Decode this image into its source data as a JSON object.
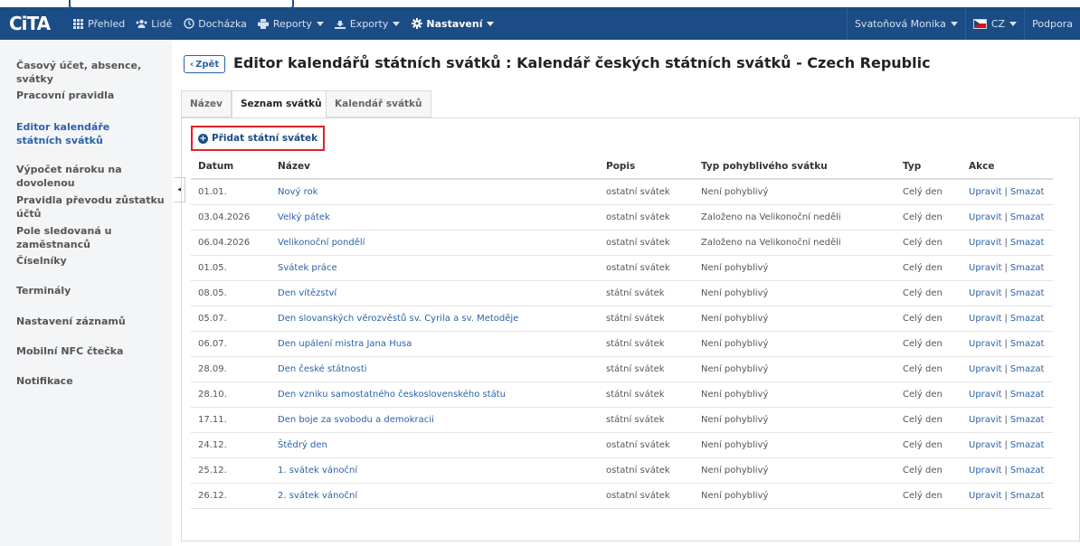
{
  "brand": {
    "logo": "CiTA"
  },
  "nav": {
    "items": [
      {
        "label": "Přehled",
        "icon": "grid-icon"
      },
      {
        "label": "Lidé",
        "icon": "people-icon"
      },
      {
        "label": "Docházka",
        "icon": "clock-icon"
      },
      {
        "label": "Reporty",
        "icon": "printer-icon"
      },
      {
        "label": "Exporty",
        "icon": "export-icon"
      },
      {
        "label": "Nastavení",
        "icon": "gear-icon"
      }
    ],
    "user": "Svatoňová Monika",
    "language": "CZ",
    "support": "Podpora"
  },
  "sidebar": {
    "items": [
      {
        "label": "Časový účet, absence, svátky"
      },
      {
        "label": "Pracovní pravidla"
      },
      {
        "label": "Editor kalendáře státních svátků"
      },
      {
        "label": "Výpočet nároku na dovolenou"
      },
      {
        "label": "Pravidla převodu zůstatku účtů"
      },
      {
        "label": "Pole sledovaná u zaměstnanců"
      },
      {
        "label": "Číselníky"
      },
      {
        "label": "Terminály"
      },
      {
        "label": "Nastavení záznamů"
      },
      {
        "label": "Mobilní NFC čtečka"
      },
      {
        "label": "Notifikace"
      }
    ],
    "active_index": 2,
    "collapse_glyph": "◂"
  },
  "main": {
    "back_label": "Zpět",
    "title": "Editor kalendářů státních svátků : Kalendář českých státních svátků - Czech Republic",
    "tabs": [
      {
        "label": "Název"
      },
      {
        "label": "Seznam svátků"
      },
      {
        "label": "Kalendář svátků"
      }
    ],
    "add_label": "Přidat státní svátek",
    "table": {
      "headers": [
        "Datum",
        "Název",
        "Popis",
        "Typ pohyblivého svátku",
        "Typ",
        "Akce"
      ],
      "action_edit": "Upravit",
      "action_sep": "|",
      "action_delete": "Smazat",
      "rows": [
        {
          "date": "01.01.",
          "name": "Nový rok",
          "desc": "ostatní svátek",
          "movable": "Není pohyblivý",
          "type": "Celý den"
        },
        {
          "date": "03.04.2026",
          "name": "Velký pátek",
          "desc": "ostatní svátek",
          "movable": "Založeno na Velikonoční neděli",
          "type": "Celý den"
        },
        {
          "date": "06.04.2026",
          "name": "Velikonoční pondělí",
          "desc": "ostatní svátek",
          "movable": "Založeno na Velikonoční neděli",
          "type": "Celý den"
        },
        {
          "date": "01.05.",
          "name": "Svátek práce",
          "desc": "ostatní svátek",
          "movable": "Není pohyblivý",
          "type": "Celý den"
        },
        {
          "date": "08.05.",
          "name": "Den vítězství",
          "desc": "státní svátek",
          "movable": "Není pohyblivý",
          "type": "Celý den"
        },
        {
          "date": "05.07.",
          "name": "Den slovanských věrozvěstů sv. Cyrila a sv. Metoděje",
          "desc": "státní svátek",
          "movable": "Není pohyblivý",
          "type": "Celý den"
        },
        {
          "date": "06.07.",
          "name": "Den upálení mistra Jana Husa",
          "desc": "státní svátek",
          "movable": "Není pohyblivý",
          "type": "Celý den"
        },
        {
          "date": "28.09.",
          "name": "Den české státnosti",
          "desc": "státní svátek",
          "movable": "Není pohyblivý",
          "type": "Celý den"
        },
        {
          "date": "28.10.",
          "name": "Den vzniku samostatného československého státu",
          "desc": "státní svátek",
          "movable": "Není pohyblivý",
          "type": "Celý den"
        },
        {
          "date": "17.11.",
          "name": "Den boje za svobodu a demokracii",
          "desc": "státní svátek",
          "movable": "Není pohyblivý",
          "type": "Celý den"
        },
        {
          "date": "24.12.",
          "name": "Štědrý den",
          "desc": "ostatní svátek",
          "movable": "Není pohyblivý",
          "type": "Celý den"
        },
        {
          "date": "25.12.",
          "name": "1. svátek vánoční",
          "desc": "ostatní svátek",
          "movable": "Není pohyblivý",
          "type": "Celý den"
        },
        {
          "date": "26.12.",
          "name": "2. svátek vánoční",
          "desc": "ostatní svátek",
          "movable": "Není pohyblivý",
          "type": "Celý den"
        }
      ]
    }
  },
  "colors": {
    "navbar": "#1c4c86",
    "link": "#2b62a8",
    "highlight_border": "#e0202a"
  }
}
